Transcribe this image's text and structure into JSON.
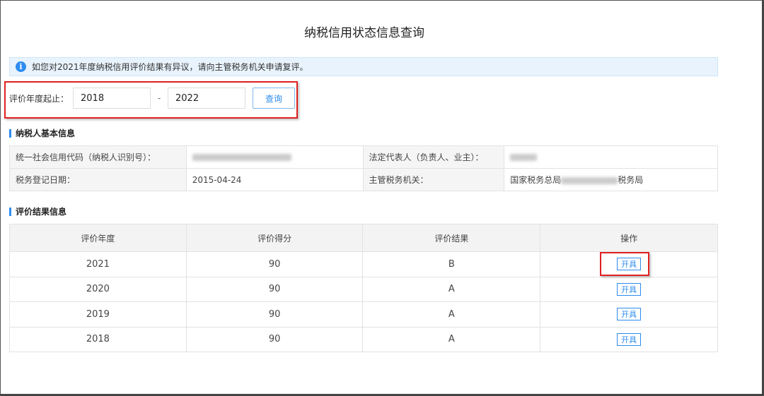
{
  "page": {
    "title": "纳税信用状态信息查询",
    "notice": "如您对2021年度纳税信用评价结果有异议，请向主管税务机关申请复评。",
    "info_icon": "info-icon"
  },
  "filter": {
    "label": "评价年度起止：",
    "start_year": "2018",
    "end_year": "2022",
    "separator": "-",
    "query_label": "查询"
  },
  "taxpayer": {
    "section_title": "纳税人基本信息",
    "credit_code_label": "统一社会信用代码（纳税人识别号）：",
    "legal_rep_label": "法定代表人（负责人、业主）：",
    "reg_date_label": "税务登记日期：",
    "reg_date": "2015-04-24",
    "tax_office_label": "主管税务机关：",
    "tax_office_prefix": "国家税务总局",
    "tax_office_suffix": "税务局"
  },
  "results": {
    "section_title": "评价结果信息",
    "headers": [
      "评价年度",
      "评价得分",
      "评价结果",
      "操作"
    ],
    "rows": [
      {
        "year": "2021",
        "score": "90",
        "grade": "B",
        "action": "开具"
      },
      {
        "year": "2020",
        "score": "90",
        "grade": "A",
        "action": "开具"
      },
      {
        "year": "2019",
        "score": "90",
        "grade": "A",
        "action": "开具"
      },
      {
        "year": "2018",
        "score": "90",
        "grade": "A",
        "action": "开具"
      }
    ]
  },
  "colors": {
    "accent": "#2d8cf0",
    "highlight": "#e02020",
    "notice_bg": "#e8f3fd"
  }
}
